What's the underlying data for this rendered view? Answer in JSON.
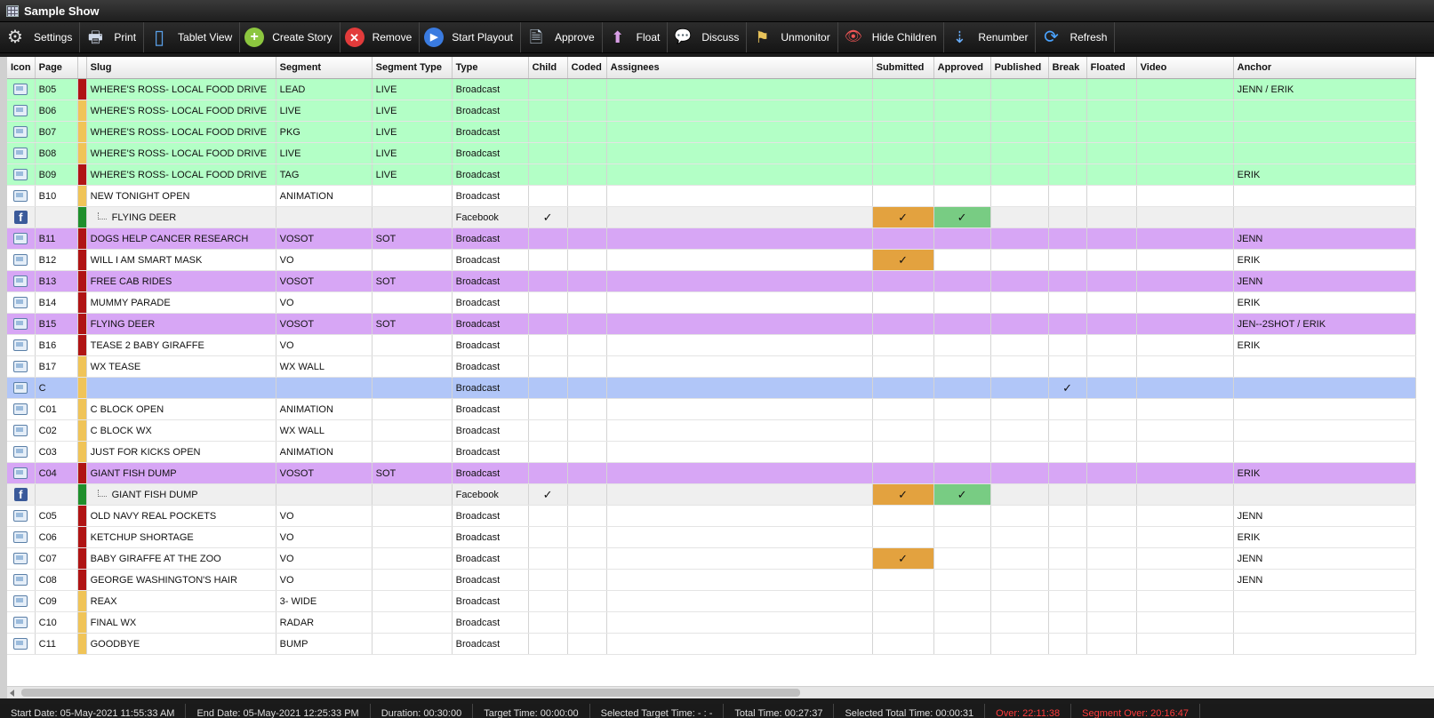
{
  "window": {
    "title": "Sample Show"
  },
  "toolbar": [
    {
      "label": "Settings",
      "icon": "gear-icon"
    },
    {
      "label": "Print",
      "icon": "printer-icon"
    },
    {
      "label": "Tablet View",
      "icon": "tablet-icon"
    },
    {
      "label": "Create Story",
      "icon": "add-icon"
    },
    {
      "label": "Remove",
      "icon": "remove-icon"
    },
    {
      "label": "Start Playout",
      "icon": "play-icon"
    },
    {
      "label": "Approve",
      "icon": "approve-document-icon"
    },
    {
      "label": "Float",
      "icon": "arrow-up-icon"
    },
    {
      "label": "Discuss",
      "icon": "speech-bubble-icon"
    },
    {
      "label": "Unmonitor",
      "icon": "flag-icon"
    },
    {
      "label": "Hide Children",
      "icon": "eye-hidden-icon"
    },
    {
      "label": "Renumber",
      "icon": "sort-az-icon"
    },
    {
      "label": "Refresh",
      "icon": "refresh-icon"
    }
  ],
  "columns": [
    "Icon",
    "Page",
    "",
    "Slug",
    "Segment",
    "Segment Type",
    "Type",
    "Child",
    "Coded",
    "Assignees",
    "Submitted",
    "Approved",
    "Published",
    "Break",
    "Floated",
    "Video",
    "Anchor"
  ],
  "rows": [
    {
      "icon": "tv",
      "page": "B05",
      "bar": "red",
      "slug": "WHERE'S ROSS- LOCAL FOOD DRIVE",
      "segment": "LEAD",
      "segtype": "LIVE",
      "type": "Broadcast",
      "anchor": "JENN / ERIK",
      "color": "green"
    },
    {
      "icon": "tv",
      "page": "B06",
      "bar": "yellow",
      "slug": "WHERE'S ROSS- LOCAL FOOD DRIVE",
      "segment": "LIVE",
      "segtype": "LIVE",
      "type": "Broadcast",
      "anchor": "",
      "color": "green"
    },
    {
      "icon": "tv",
      "page": "B07",
      "bar": "yellow",
      "slug": "WHERE'S ROSS- LOCAL FOOD DRIVE",
      "segment": "PKG",
      "segtype": "LIVE",
      "type": "Broadcast",
      "anchor": "",
      "color": "green"
    },
    {
      "icon": "tv",
      "page": "B08",
      "bar": "yellow",
      "slug": "WHERE'S ROSS- LOCAL FOOD DRIVE",
      "segment": "LIVE",
      "segtype": "LIVE",
      "type": "Broadcast",
      "anchor": "",
      "color": "green"
    },
    {
      "icon": "tv",
      "page": "B09",
      "bar": "red",
      "slug": "WHERE'S ROSS- LOCAL FOOD DRIVE",
      "segment": "TAG",
      "segtype": "LIVE",
      "type": "Broadcast",
      "anchor": "ERIK",
      "color": "green"
    },
    {
      "icon": "tv",
      "page": "B10",
      "bar": "yellow",
      "slug": "NEW TONIGHT OPEN",
      "segment": "ANIMATION",
      "segtype": "",
      "type": "Broadcast",
      "anchor": "",
      "color": "white"
    },
    {
      "icon": "fb",
      "page": "",
      "bar": "green",
      "slug": "FLYING DEER",
      "segment": "",
      "segtype": "",
      "type": "Facebook",
      "child": "✓",
      "submitted": "✓",
      "approved": "✓",
      "anchor": "",
      "color": "gray",
      "childrow": true
    },
    {
      "icon": "tv",
      "page": "B11",
      "bar": "red",
      "slug": "DOGS HELP CANCER RESEARCH",
      "segment": "VOSOT",
      "segtype": "SOT",
      "type": "Broadcast",
      "anchor": "JENN",
      "color": "purple"
    },
    {
      "icon": "tv",
      "page": "B12",
      "bar": "red",
      "slug": "WILL I AM SMART MASK",
      "segment": "VO",
      "segtype": "",
      "type": "Broadcast",
      "submitted": "✓",
      "anchor": "ERIK",
      "color": "white"
    },
    {
      "icon": "tv",
      "page": "B13",
      "bar": "red",
      "slug": "FREE CAB RIDES",
      "segment": "VOSOT",
      "segtype": "SOT",
      "type": "Broadcast",
      "anchor": "JENN",
      "color": "purple"
    },
    {
      "icon": "tv",
      "page": "B14",
      "bar": "red",
      "slug": "MUMMY PARADE",
      "segment": "VO",
      "segtype": "",
      "type": "Broadcast",
      "anchor": "ERIK",
      "color": "white"
    },
    {
      "icon": "tv",
      "page": "B15",
      "bar": "red",
      "slug": "FLYING DEER",
      "segment": "VOSOT",
      "segtype": "SOT",
      "type": "Broadcast",
      "anchor": "JEN--2SHOT / ERIK",
      "color": "purple"
    },
    {
      "icon": "tv",
      "page": "B16",
      "bar": "red",
      "slug": "TEASE 2 BABY GIRAFFE",
      "segment": "VO",
      "segtype": "",
      "type": "Broadcast",
      "anchor": "ERIK",
      "color": "white"
    },
    {
      "icon": "tv",
      "page": "B17",
      "bar": "yellow",
      "slug": "WX TEASE",
      "segment": "WX WALL",
      "segtype": "",
      "type": "Broadcast",
      "anchor": "",
      "color": "white"
    },
    {
      "icon": "tv",
      "page": "C",
      "bar": "yellow",
      "slug": "",
      "segment": "",
      "segtype": "",
      "type": "Broadcast",
      "break": "✓",
      "anchor": "",
      "color": "blue"
    },
    {
      "icon": "tv",
      "page": "C01",
      "bar": "yellow",
      "slug": "C BLOCK OPEN",
      "segment": "ANIMATION",
      "segtype": "",
      "type": "Broadcast",
      "anchor": "",
      "color": "white"
    },
    {
      "icon": "tv",
      "page": "C02",
      "bar": "yellow",
      "slug": "C BLOCK WX",
      "segment": "WX WALL",
      "segtype": "",
      "type": "Broadcast",
      "anchor": "",
      "color": "white"
    },
    {
      "icon": "tv",
      "page": "C03",
      "bar": "yellow",
      "slug": "JUST FOR KICKS OPEN",
      "segment": "ANIMATION",
      "segtype": "",
      "type": "Broadcast",
      "anchor": "",
      "color": "white"
    },
    {
      "icon": "tv",
      "page": "C04",
      "bar": "red",
      "slug": "GIANT FISH DUMP",
      "segment": "VOSOT",
      "segtype": "SOT",
      "type": "Broadcast",
      "anchor": "ERIK",
      "color": "purple"
    },
    {
      "icon": "fb",
      "page": "",
      "bar": "green",
      "slug": "GIANT FISH DUMP",
      "segment": "",
      "segtype": "",
      "type": "Facebook",
      "child": "✓",
      "submitted": "✓",
      "approved": "✓",
      "anchor": "",
      "color": "gray",
      "childrow": true
    },
    {
      "icon": "tv",
      "page": "C05",
      "bar": "red",
      "slug": "OLD NAVY REAL POCKETS",
      "segment": "VO",
      "segtype": "",
      "type": "Broadcast",
      "anchor": "JENN",
      "color": "white"
    },
    {
      "icon": "tv",
      "page": "C06",
      "bar": "red",
      "slug": "KETCHUP SHORTAGE",
      "segment": "VO",
      "segtype": "",
      "type": "Broadcast",
      "anchor": "ERIK",
      "color": "white"
    },
    {
      "icon": "tv",
      "page": "C07",
      "bar": "red",
      "slug": "BABY GIRAFFE AT THE ZOO",
      "segment": "VO",
      "segtype": "",
      "type": "Broadcast",
      "submitted": "✓",
      "anchor": "JENN",
      "color": "white"
    },
    {
      "icon": "tv",
      "page": "C08",
      "bar": "red",
      "slug": "GEORGE WASHINGTON'S HAIR",
      "segment": "VO",
      "segtype": "",
      "type": "Broadcast",
      "anchor": "JENN",
      "color": "white"
    },
    {
      "icon": "tv",
      "page": "C09",
      "bar": "yellow",
      "slug": "REAX",
      "segment": "3- WIDE",
      "segtype": "",
      "type": "Broadcast",
      "anchor": "",
      "color": "white"
    },
    {
      "icon": "tv",
      "page": "C10",
      "bar": "yellow",
      "slug": "FINAL WX",
      "segment": "RADAR",
      "segtype": "",
      "type": "Broadcast",
      "anchor": "",
      "color": "white"
    },
    {
      "icon": "tv",
      "page": "C11",
      "bar": "yellow",
      "slug": "GOODBYE",
      "segment": "BUMP",
      "segtype": "",
      "type": "Broadcast",
      "anchor": "",
      "color": "white"
    }
  ],
  "status": [
    {
      "text": "Start Date: 05-May-2021 11:55:33 AM",
      "alert": false
    },
    {
      "text": "End Date: 05-May-2021 12:25:33 PM",
      "alert": false
    },
    {
      "text": "Duration: 00:30:00",
      "alert": false
    },
    {
      "text": "Target Time: 00:00:00",
      "alert": false
    },
    {
      "text": "Selected Target Time: - : -",
      "alert": false
    },
    {
      "text": "Total Time: 00:27:37",
      "alert": false
    },
    {
      "text": "Selected Total Time: 00:00:31",
      "alert": false
    },
    {
      "text": "Over: 22:11:38",
      "alert": true
    },
    {
      "text": "Segment Over: 20:16:47",
      "alert": true
    }
  ],
  "colors": {
    "green_row": "#b3ffc6",
    "purple_row": "#d7a6f5",
    "blue_row": "#b1c6f8",
    "bar_red": "#b01414",
    "bar_yellow": "#f0c458",
    "bar_green": "#1f8f2c",
    "submitted": "#e3a23f",
    "approved": "#78cc83"
  }
}
